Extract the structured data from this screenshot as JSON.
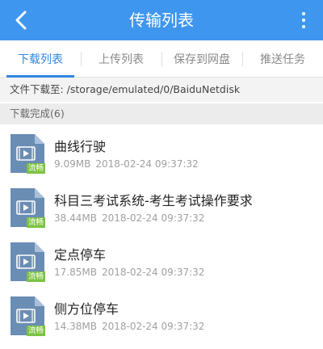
{
  "header": {
    "title": "传输列表",
    "back_icon": "chevron-left-icon",
    "menu_icon": "more-vertical-icon",
    "color": "#3f96ef"
  },
  "tabs": [
    {
      "label": "下载列表",
      "active": true
    },
    {
      "label": "上传列表",
      "active": false
    },
    {
      "label": "保存到网盘",
      "active": false
    },
    {
      "label": "推送任务",
      "active": false
    }
  ],
  "path_bar": {
    "text": "文件下载至: /storage/emulated/0/BaiduNetdisk"
  },
  "section": {
    "title": "下载完成(6)"
  },
  "file_icon": {
    "type": "video-file-icon",
    "badge": "流畅",
    "badge_color": "#7cc242"
  },
  "items": [
    {
      "name": "曲线行驶",
      "size": "9.09MB",
      "date": "2018-02-24 09:37:32"
    },
    {
      "name": "科目三考试系统-考生考试操作要求",
      "size": "38.44MB",
      "date": "2018-02-24 09:37:32"
    },
    {
      "name": "定点停车",
      "size": "17.85MB",
      "date": "2018-02-24 09:37:32"
    },
    {
      "name": "侧方位停车",
      "size": "14.38MB",
      "date": "2018-02-24 09:37:32"
    }
  ]
}
